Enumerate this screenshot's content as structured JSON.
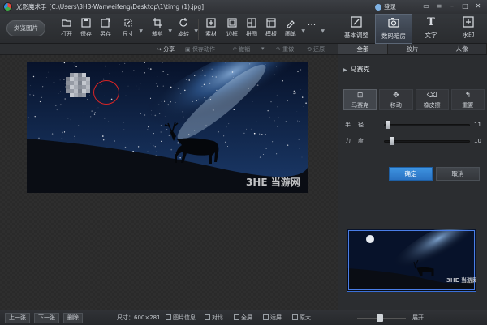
{
  "titlebar": {
    "app_name": "光影魔术手",
    "file_path": "[C:\\Users\\3H3-Wanweifeng\\Desktop\\1\\timg (1).jpg]",
    "login": "登录"
  },
  "toolbar": {
    "browse": "浏览图片",
    "tools": [
      {
        "label": "打开",
        "icon": "open-icon"
      },
      {
        "label": "保存",
        "icon": "save-icon"
      },
      {
        "label": "另存",
        "icon": "save-as-icon"
      },
      {
        "label": "尺寸",
        "icon": "resize-icon"
      },
      {
        "label": "裁剪",
        "icon": "crop-icon"
      },
      {
        "label": "旋转",
        "icon": "rotate-icon"
      },
      {
        "label": "素材",
        "icon": "material-icon"
      },
      {
        "label": "边框",
        "icon": "border-icon"
      },
      {
        "label": "拼图",
        "icon": "collage-icon"
      },
      {
        "label": "模板",
        "icon": "template-icon"
      },
      {
        "label": "画笔",
        "icon": "brush-icon"
      },
      {
        "label": "...",
        "icon": "more-icon"
      }
    ]
  },
  "right_tabs": [
    {
      "label": "基本调整",
      "icon": "adjust-icon"
    },
    {
      "label": "数码暗房",
      "icon": "camera-icon"
    },
    {
      "label": "文字",
      "icon": "text-icon"
    },
    {
      "label": "水印",
      "icon": "watermark-icon"
    }
  ],
  "subbar": {
    "share": "分享",
    "save_action": "保存动作",
    "undo": "撤销",
    "redo": "重做",
    "restore": "还原"
  },
  "canvas": {
    "watermark": "3HE 当游网"
  },
  "panel": {
    "tabs": [
      "全部",
      "胶片",
      "人像"
    ],
    "section_title": "马赛克",
    "mosaic_tools": [
      {
        "label": "马赛克",
        "icon": "mosaic-icon"
      },
      {
        "label": "移动",
        "icon": "move-icon"
      },
      {
        "label": "橡皮擦",
        "icon": "eraser-icon"
      },
      {
        "label": "重置",
        "icon": "reset-icon"
      }
    ],
    "sliders": [
      {
        "label": "半径",
        "value": "11",
        "level": 0.0
      },
      {
        "label": "力度",
        "value": "10",
        "level": 0.05
      }
    ],
    "confirm": "确定",
    "cancel": "取消",
    "preview_watermark": "3HE 当游网"
  },
  "bottombar": {
    "prev": "上一张",
    "next": "下一张",
    "delete": "删除",
    "size": "尺寸：600×281",
    "info": "图片信息",
    "compare": "对比",
    "fullscreen": "全屏",
    "fit": "适屏",
    "zoom_in": "原大",
    "unfold": "展开"
  },
  "colors": {
    "accent": "#2f7fd0",
    "selection_ring": "#d92525",
    "panel_bg": "#2b2d30"
  }
}
